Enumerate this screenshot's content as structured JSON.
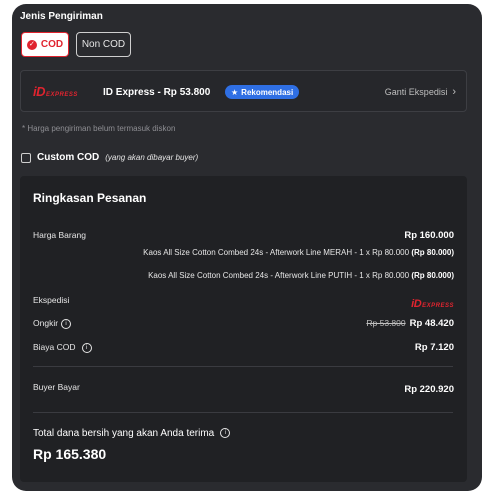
{
  "shipping": {
    "section_title": "Jenis Pengiriman",
    "cod_label": "COD",
    "non_cod_label": "Non COD",
    "courier": {
      "logo_main": "iD",
      "logo_sub": "EXPRESS",
      "name_price": "ID Express - Rp 53.800",
      "badge": "Rekomendasi",
      "change_link": "Ganti Ekspedisi"
    },
    "note": "* Harga pengiriman belum termasuk diskon",
    "custom_cod_label": "Custom COD",
    "custom_cod_hint": "(yang akan dibayar buyer)"
  },
  "summary": {
    "title": "Ringkasan Pesanan",
    "goods_label": "Harga Barang",
    "goods_value": "Rp 160.000",
    "items": [
      {
        "text": "Kaos All Size Cotton Combed 24s - Afterwork Line MERAH - 1 x Rp 80.000",
        "subtotal": "(Rp 80.000)"
      },
      {
        "text": "Kaos All Size Cotton Combed 24s - Afterwork Line PUTIH - 1 x Rp 80.000",
        "subtotal": "(Rp 80.000)"
      }
    ],
    "courier_label": "Ekspedisi",
    "shipping_label": "Ongkir",
    "shipping_old": "Rp 53.800",
    "shipping_value": "Rp 48.420",
    "cod_fee_label": "Biaya COD",
    "cod_fee_value": "Rp 7.120",
    "buyer_pay_label": "Buyer Bayar",
    "buyer_pay_value": "Rp 220.920",
    "net_label": "Total dana bersih yang akan Anda terima",
    "net_value": "Rp 165.380"
  },
  "colors": {
    "accent_red": "#e0242f",
    "badge_blue": "#2f6fe4",
    "panel_bg": "#2a2b2f"
  }
}
